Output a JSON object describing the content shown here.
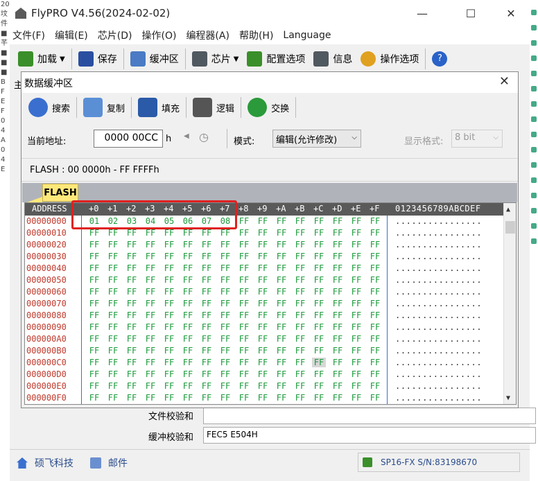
{
  "window": {
    "title": "FlyPRO V4.56(2024-02-02)",
    "minimize": "—",
    "maximize": "☐",
    "close": "✕"
  },
  "menu": [
    "文件(F)",
    "编辑(E)",
    "芯片(D)",
    "操作(O)",
    "编程器(A)",
    "帮助(H)",
    "Language"
  ],
  "toolbar": [
    {
      "label": "加载",
      "icon": "load-icon",
      "color": "#3a8f2a",
      "dropdown": true
    },
    {
      "label": "保存",
      "icon": "save-icon",
      "color": "#2b4fa0"
    },
    {
      "label": "缓冲区",
      "icon": "buffer-icon",
      "color": "#4a7bc4"
    },
    {
      "label": "芯片",
      "icon": "chip-icon",
      "color": "#505860",
      "dropdown": true
    },
    {
      "label": "配置选项",
      "icon": "config-icon",
      "color": "#3a8f2a"
    },
    {
      "label": "信息",
      "icon": "info-icon",
      "color": "#505860"
    },
    {
      "label": "操作选项",
      "icon": "operation-options-icon",
      "color": "#e0a020"
    },
    {
      "label": "",
      "icon": "help-icon",
      "color": "#2a62c8"
    }
  ],
  "dialog": {
    "title": "数据缓冲区",
    "close": "✕",
    "tools": [
      {
        "label": "搜索",
        "icon": "search-icon",
        "color": "#3a6fcf"
      },
      {
        "label": "复制",
        "icon": "copy-icon",
        "color": "#5a8fd6"
      },
      {
        "label": "填充",
        "icon": "fill-icon",
        "color": "#2a5aa8"
      },
      {
        "label": "逻辑",
        "icon": "logic-icon",
        "color": "#555"
      },
      {
        "label": "交换",
        "icon": "swap-icon",
        "color": "#2a9a3a"
      }
    ],
    "address_label": "当前地址:",
    "address_value": "0000 00CC",
    "address_unit": "h",
    "mode_label": "模式:",
    "mode_value": "编辑(允许修改)",
    "format_label": "显示格式:",
    "format_value": "8 bit",
    "range": "FLASH : 00 0000h - FF FFFFh",
    "tab": "FLASH",
    "hex": {
      "header_addr": "ADDRESS",
      "header_cols": [
        "+0",
        "+1",
        "+2",
        "+3",
        "+4",
        "+5",
        "+6",
        "+7",
        "+8",
        "+9",
        "+A",
        "+B",
        "+C",
        "+D",
        "+E",
        "+F"
      ],
      "header_chars": "0123456789ABCDEF",
      "rows": [
        {
          "addr": "00000000",
          "bytes": [
            "01",
            "02",
            "03",
            "04",
            "05",
            "06",
            "07",
            "08",
            "FF",
            "FF",
            "FF",
            "FF",
            "FF",
            "FF",
            "FF",
            "FF"
          ],
          "chars": "................"
        },
        {
          "addr": "00000010",
          "bytes": [
            "FF",
            "FF",
            "FF",
            "FF",
            "FF",
            "FF",
            "FF",
            "FF",
            "FF",
            "FF",
            "FF",
            "FF",
            "FF",
            "FF",
            "FF",
            "FF"
          ],
          "chars": "................"
        },
        {
          "addr": "00000020",
          "bytes": [
            "FF",
            "FF",
            "FF",
            "FF",
            "FF",
            "FF",
            "FF",
            "FF",
            "FF",
            "FF",
            "FF",
            "FF",
            "FF",
            "FF",
            "FF",
            "FF"
          ],
          "chars": "................"
        },
        {
          "addr": "00000030",
          "bytes": [
            "FF",
            "FF",
            "FF",
            "FF",
            "FF",
            "FF",
            "FF",
            "FF",
            "FF",
            "FF",
            "FF",
            "FF",
            "FF",
            "FF",
            "FF",
            "FF"
          ],
          "chars": "................"
        },
        {
          "addr": "00000040",
          "bytes": [
            "FF",
            "FF",
            "FF",
            "FF",
            "FF",
            "FF",
            "FF",
            "FF",
            "FF",
            "FF",
            "FF",
            "FF",
            "FF",
            "FF",
            "FF",
            "FF"
          ],
          "chars": "................"
        },
        {
          "addr": "00000050",
          "bytes": [
            "FF",
            "FF",
            "FF",
            "FF",
            "FF",
            "FF",
            "FF",
            "FF",
            "FF",
            "FF",
            "FF",
            "FF",
            "FF",
            "FF",
            "FF",
            "FF"
          ],
          "chars": "................"
        },
        {
          "addr": "00000060",
          "bytes": [
            "FF",
            "FF",
            "FF",
            "FF",
            "FF",
            "FF",
            "FF",
            "FF",
            "FF",
            "FF",
            "FF",
            "FF",
            "FF",
            "FF",
            "FF",
            "FF"
          ],
          "chars": "................"
        },
        {
          "addr": "00000070",
          "bytes": [
            "FF",
            "FF",
            "FF",
            "FF",
            "FF",
            "FF",
            "FF",
            "FF",
            "FF",
            "FF",
            "FF",
            "FF",
            "FF",
            "FF",
            "FF",
            "FF"
          ],
          "chars": "................"
        },
        {
          "addr": "00000080",
          "bytes": [
            "FF",
            "FF",
            "FF",
            "FF",
            "FF",
            "FF",
            "FF",
            "FF",
            "FF",
            "FF",
            "FF",
            "FF",
            "FF",
            "FF",
            "FF",
            "FF"
          ],
          "chars": "................"
        },
        {
          "addr": "00000090",
          "bytes": [
            "FF",
            "FF",
            "FF",
            "FF",
            "FF",
            "FF",
            "FF",
            "FF",
            "FF",
            "FF",
            "FF",
            "FF",
            "FF",
            "FF",
            "FF",
            "FF"
          ],
          "chars": "................"
        },
        {
          "addr": "000000A0",
          "bytes": [
            "FF",
            "FF",
            "FF",
            "FF",
            "FF",
            "FF",
            "FF",
            "FF",
            "FF",
            "FF",
            "FF",
            "FF",
            "FF",
            "FF",
            "FF",
            "FF"
          ],
          "chars": "................"
        },
        {
          "addr": "000000B0",
          "bytes": [
            "FF",
            "FF",
            "FF",
            "FF",
            "FF",
            "FF",
            "FF",
            "FF",
            "FF",
            "FF",
            "FF",
            "FF",
            "FF",
            "FF",
            "FF",
            "FF"
          ],
          "chars": "................"
        },
        {
          "addr": "000000C0",
          "bytes": [
            "FF",
            "FF",
            "FF",
            "FF",
            "FF",
            "FF",
            "FF",
            "FF",
            "FF",
            "FF",
            "FF",
            "FF",
            "FF",
            "FF",
            "FF",
            "FF"
          ],
          "chars": "................",
          "highlight": 12
        },
        {
          "addr": "000000D0",
          "bytes": [
            "FF",
            "FF",
            "FF",
            "FF",
            "FF",
            "FF",
            "FF",
            "FF",
            "FF",
            "FF",
            "FF",
            "FF",
            "FF",
            "FF",
            "FF",
            "FF"
          ],
          "chars": "................"
        },
        {
          "addr": "000000E0",
          "bytes": [
            "FF",
            "FF",
            "FF",
            "FF",
            "FF",
            "FF",
            "FF",
            "FF",
            "FF",
            "FF",
            "FF",
            "FF",
            "FF",
            "FF",
            "FF",
            "FF"
          ],
          "chars": "................"
        },
        {
          "addr": "000000F0",
          "bytes": [
            "FF",
            "FF",
            "FF",
            "FF",
            "FF",
            "FF",
            "FF",
            "FF",
            "FF",
            "FF",
            "FF",
            "FF",
            "FF",
            "FF",
            "FF",
            "FF"
          ],
          "chars": "................"
        }
      ]
    }
  },
  "checksum": {
    "file_label": "文件校验和",
    "file_value": "",
    "buffer_label": "缓冲校验和",
    "buffer_value": "FEC5 E504H"
  },
  "status": {
    "company": "硕飞科技",
    "mail": "邮件",
    "device": "SP16-FX  S/N:83198670"
  },
  "colors": {
    "accent": "#e02020",
    "address": "#c0392b",
    "bytes": "#1a9a3a",
    "header": "#5a5a5a",
    "tab": "#ffe87a"
  }
}
